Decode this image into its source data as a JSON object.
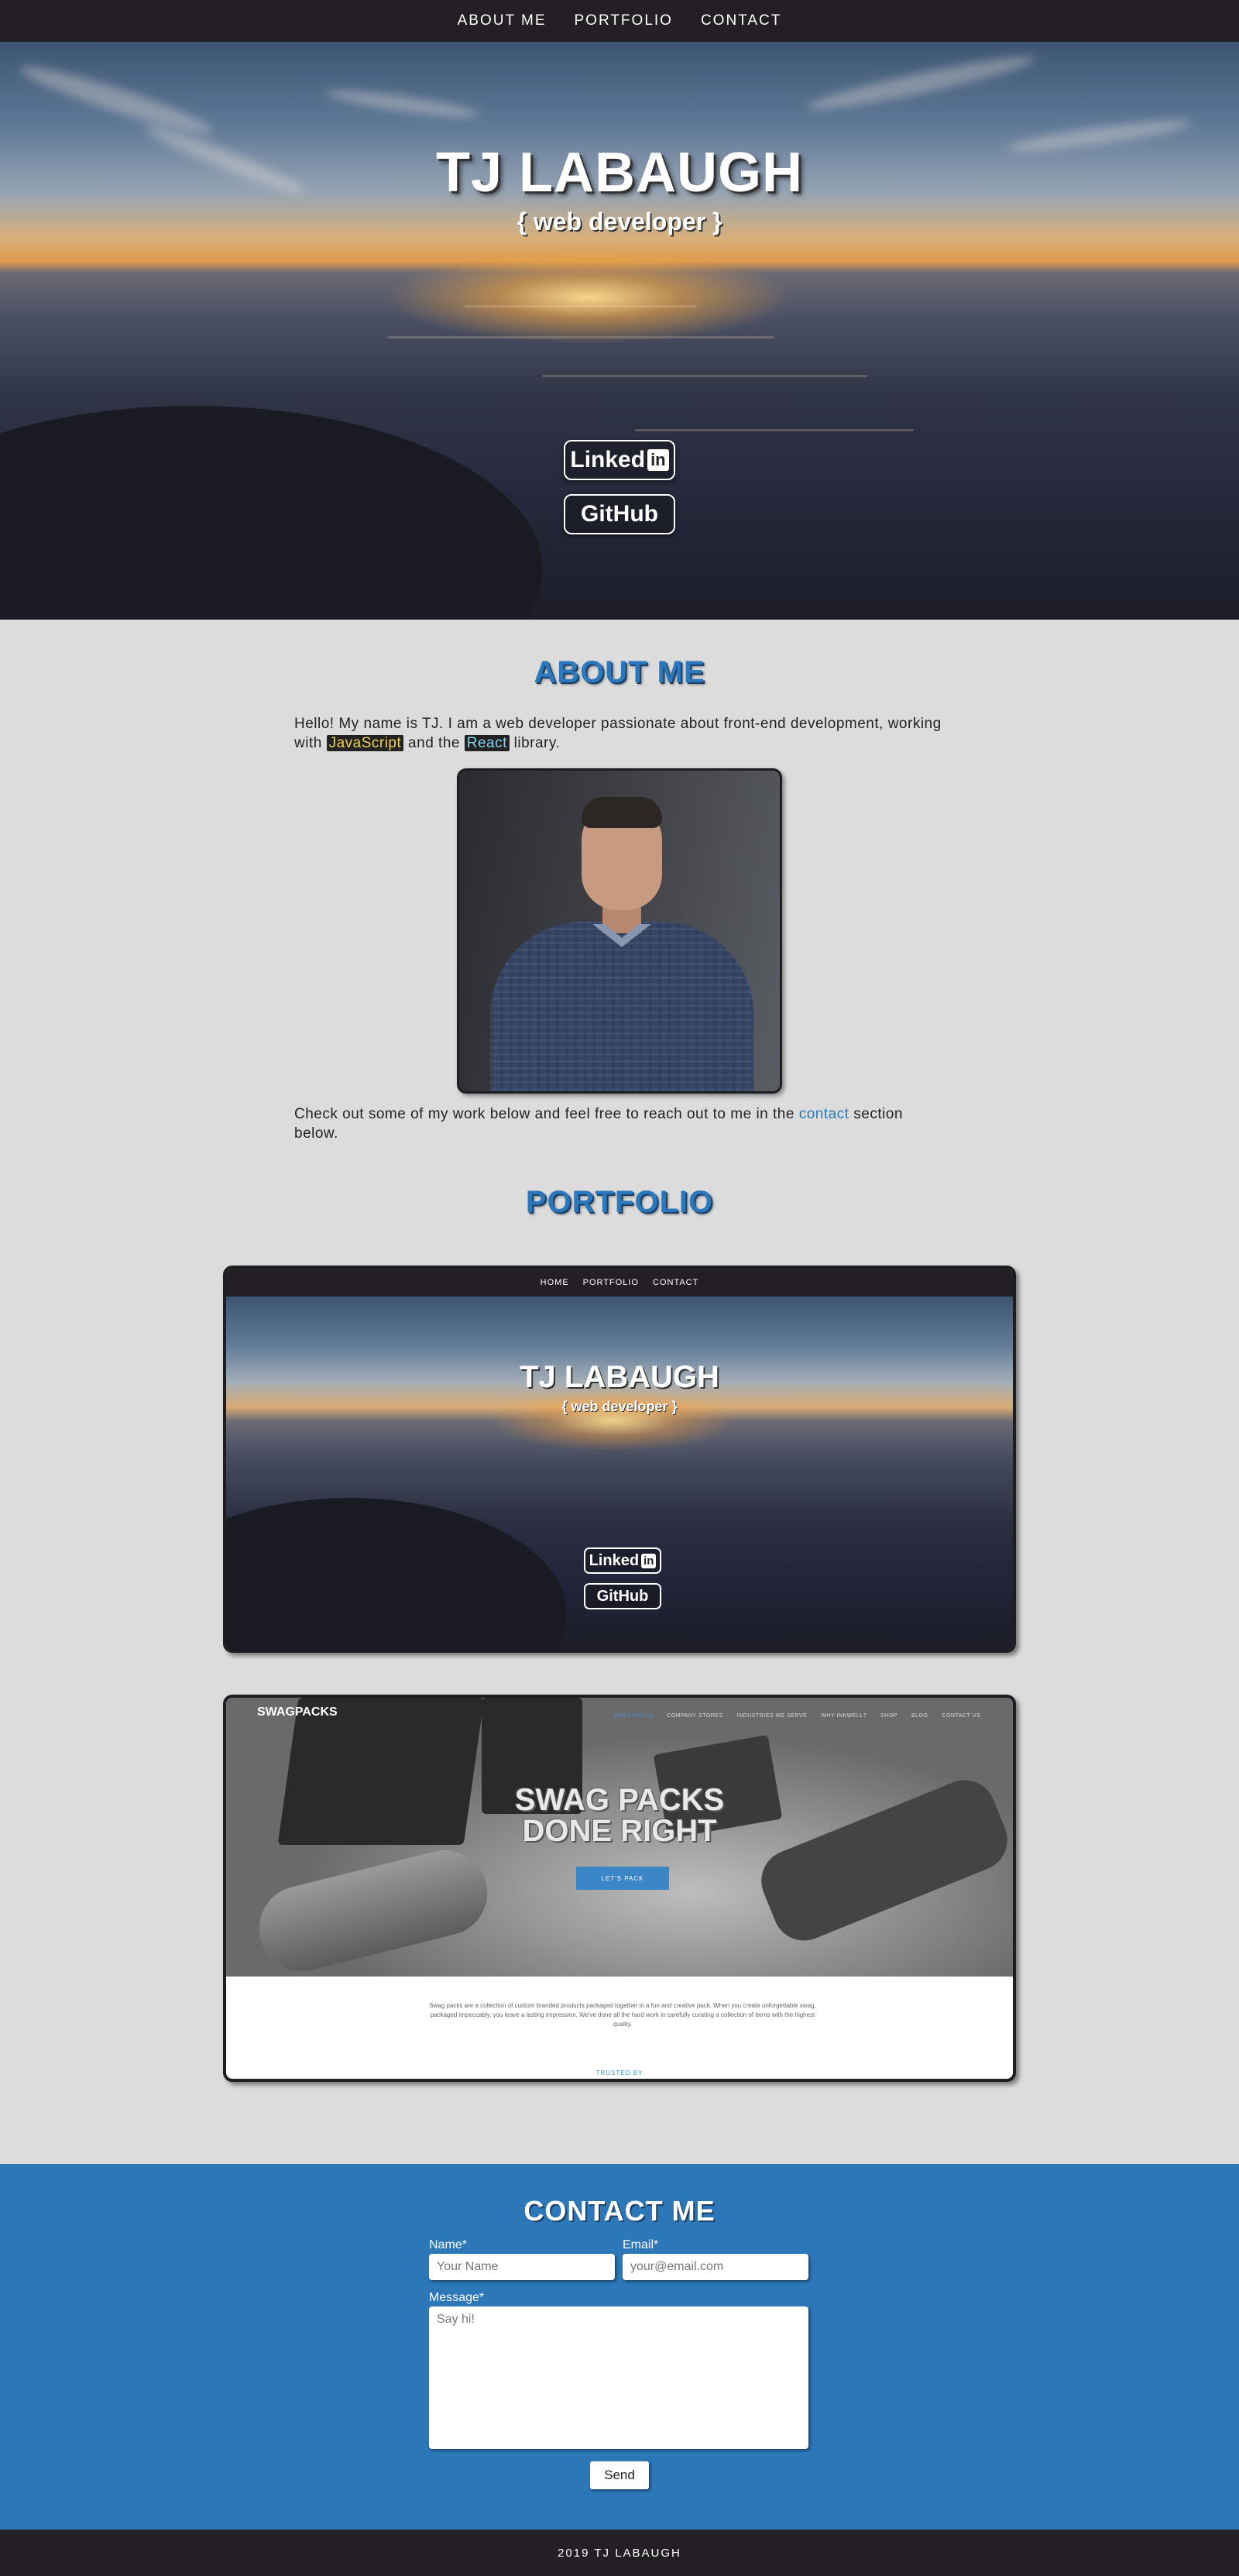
{
  "nav": {
    "items": [
      "ABOUT ME",
      "PORTFOLIO",
      "CONTACT"
    ]
  },
  "hero": {
    "title": "TJ LABAUGH",
    "subtitle": "{ web developer }",
    "linkedin_text": "Linked",
    "linkedin_box": "in",
    "github_text": "GitHub"
  },
  "about": {
    "heading": "ABOUT ME",
    "intro_before": "Hello! My name is TJ. I am a web developer passionate about front-end development, working with ",
    "intro_js": "JavaScript",
    "intro_mid": " and the ",
    "intro_react": "React",
    "intro_after": " library.",
    "outro_before": "Check out some of my work below and feel free to reach out to me in the ",
    "outro_link": "contact",
    "outro_after": " section below."
  },
  "portfolio": {
    "heading": "PORTFOLIO",
    "card1": {
      "nav": [
        "HOME",
        "PORTFOLIO",
        "CONTACT"
      ],
      "title": "TJ LABAUGH",
      "subtitle": "{ web developer }",
      "linkedin_text": "Linked",
      "linkedin_box": "in",
      "github_text": "GitHub"
    },
    "card2": {
      "logo": "SWAGPACKS",
      "nav": [
        "SWAG PACKS",
        "COMPANY STORES",
        "INDUSTRIES WE SERVE",
        "WHY INKWELL?",
        "SHOP",
        "BLOG",
        "CONTACT US"
      ],
      "title_line1": "SWAG PACKS",
      "title_line2": "DONE RIGHT",
      "button": "LET'S PACK",
      "text": "Swag packs are a collection of custom branded products packaged together in a fun and creative pack. When you create unforgettable swag, packaged impeccably, you leave a lasting impression. We've done all the hard work in carefully curating a collection of items with the highest quality.",
      "trusted": "TRUSTED BY"
    }
  },
  "contact": {
    "heading": "CONTACT ME",
    "name_label": "Name*",
    "name_placeholder": "Your Name",
    "email_label": "Email*",
    "email_placeholder": "your@email.com",
    "message_label": "Message*",
    "message_placeholder": "Say hi!",
    "send_label": "Send"
  },
  "footer": {
    "text": "2019 TJ LABAUGH"
  }
}
